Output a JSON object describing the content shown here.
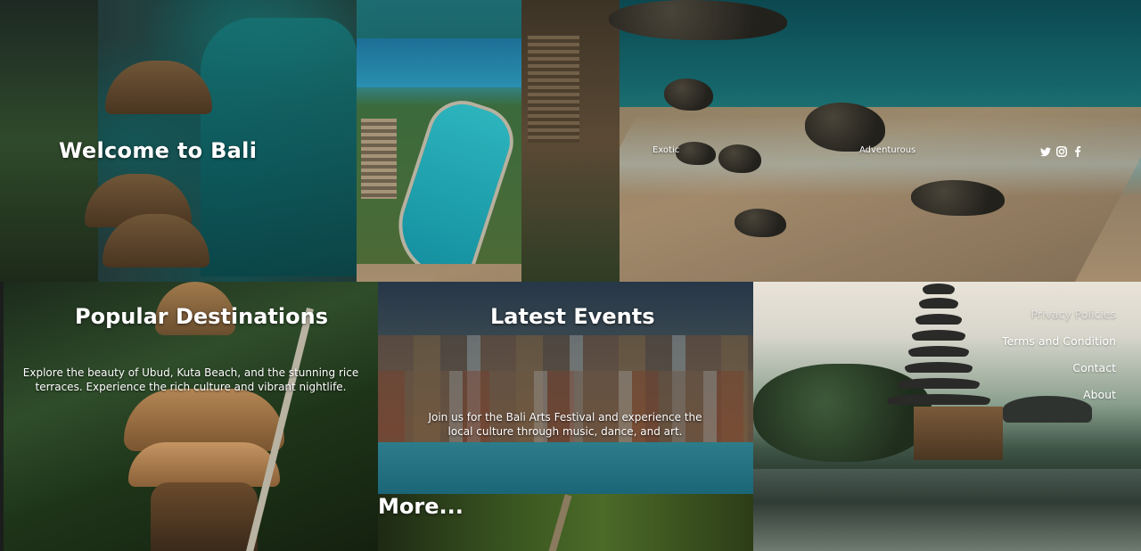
{
  "hero": {
    "title": "Welcome to Bali",
    "nav": {
      "exotic": "Exotic",
      "adventurous": "Adventurous"
    },
    "social_icons": [
      "twitter-icon",
      "instagram-icon",
      "facebook-icon"
    ]
  },
  "panels": {
    "destinations": {
      "title": "Popular Destinations",
      "text": "Explore the beauty of Ubud, Kuta Beach, and the stunning rice terraces. Experience the rich culture and vibrant nightlife."
    },
    "events": {
      "title": "Latest Events",
      "text": "Join us for the Bali Arts Festival and experience the local culture through music, dance, and art.",
      "more": "More..."
    },
    "footer": {
      "links": [
        "Privacy Policies",
        "Terms and Condition",
        "Contact",
        "About"
      ]
    }
  },
  "colors": {
    "text": "#ffffff",
    "dark_background": "#0e1a1e"
  }
}
